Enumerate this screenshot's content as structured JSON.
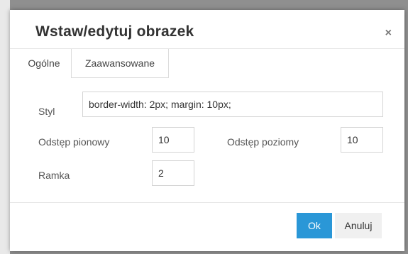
{
  "dialog": {
    "title": "Wstaw/edytuj obrazek",
    "close_symbol": "×",
    "close_icon": "close-icon"
  },
  "tabs": [
    {
      "label": "Ogólne",
      "active": true
    },
    {
      "label": "Zaawansowane",
      "active": false
    }
  ],
  "fields": {
    "style": {
      "label": "Styl",
      "value": "border-width: 2px; margin: 10px;"
    },
    "vspace": {
      "label": "Odstęp pionowy",
      "value": "10"
    },
    "hspace": {
      "label": "Odstęp poziomy",
      "value": "10"
    },
    "border": {
      "label": "Ramka",
      "value": "2"
    }
  },
  "buttons": {
    "ok": "Ok",
    "cancel": "Anuluj"
  },
  "colors": {
    "primary": "#2a97d7"
  }
}
